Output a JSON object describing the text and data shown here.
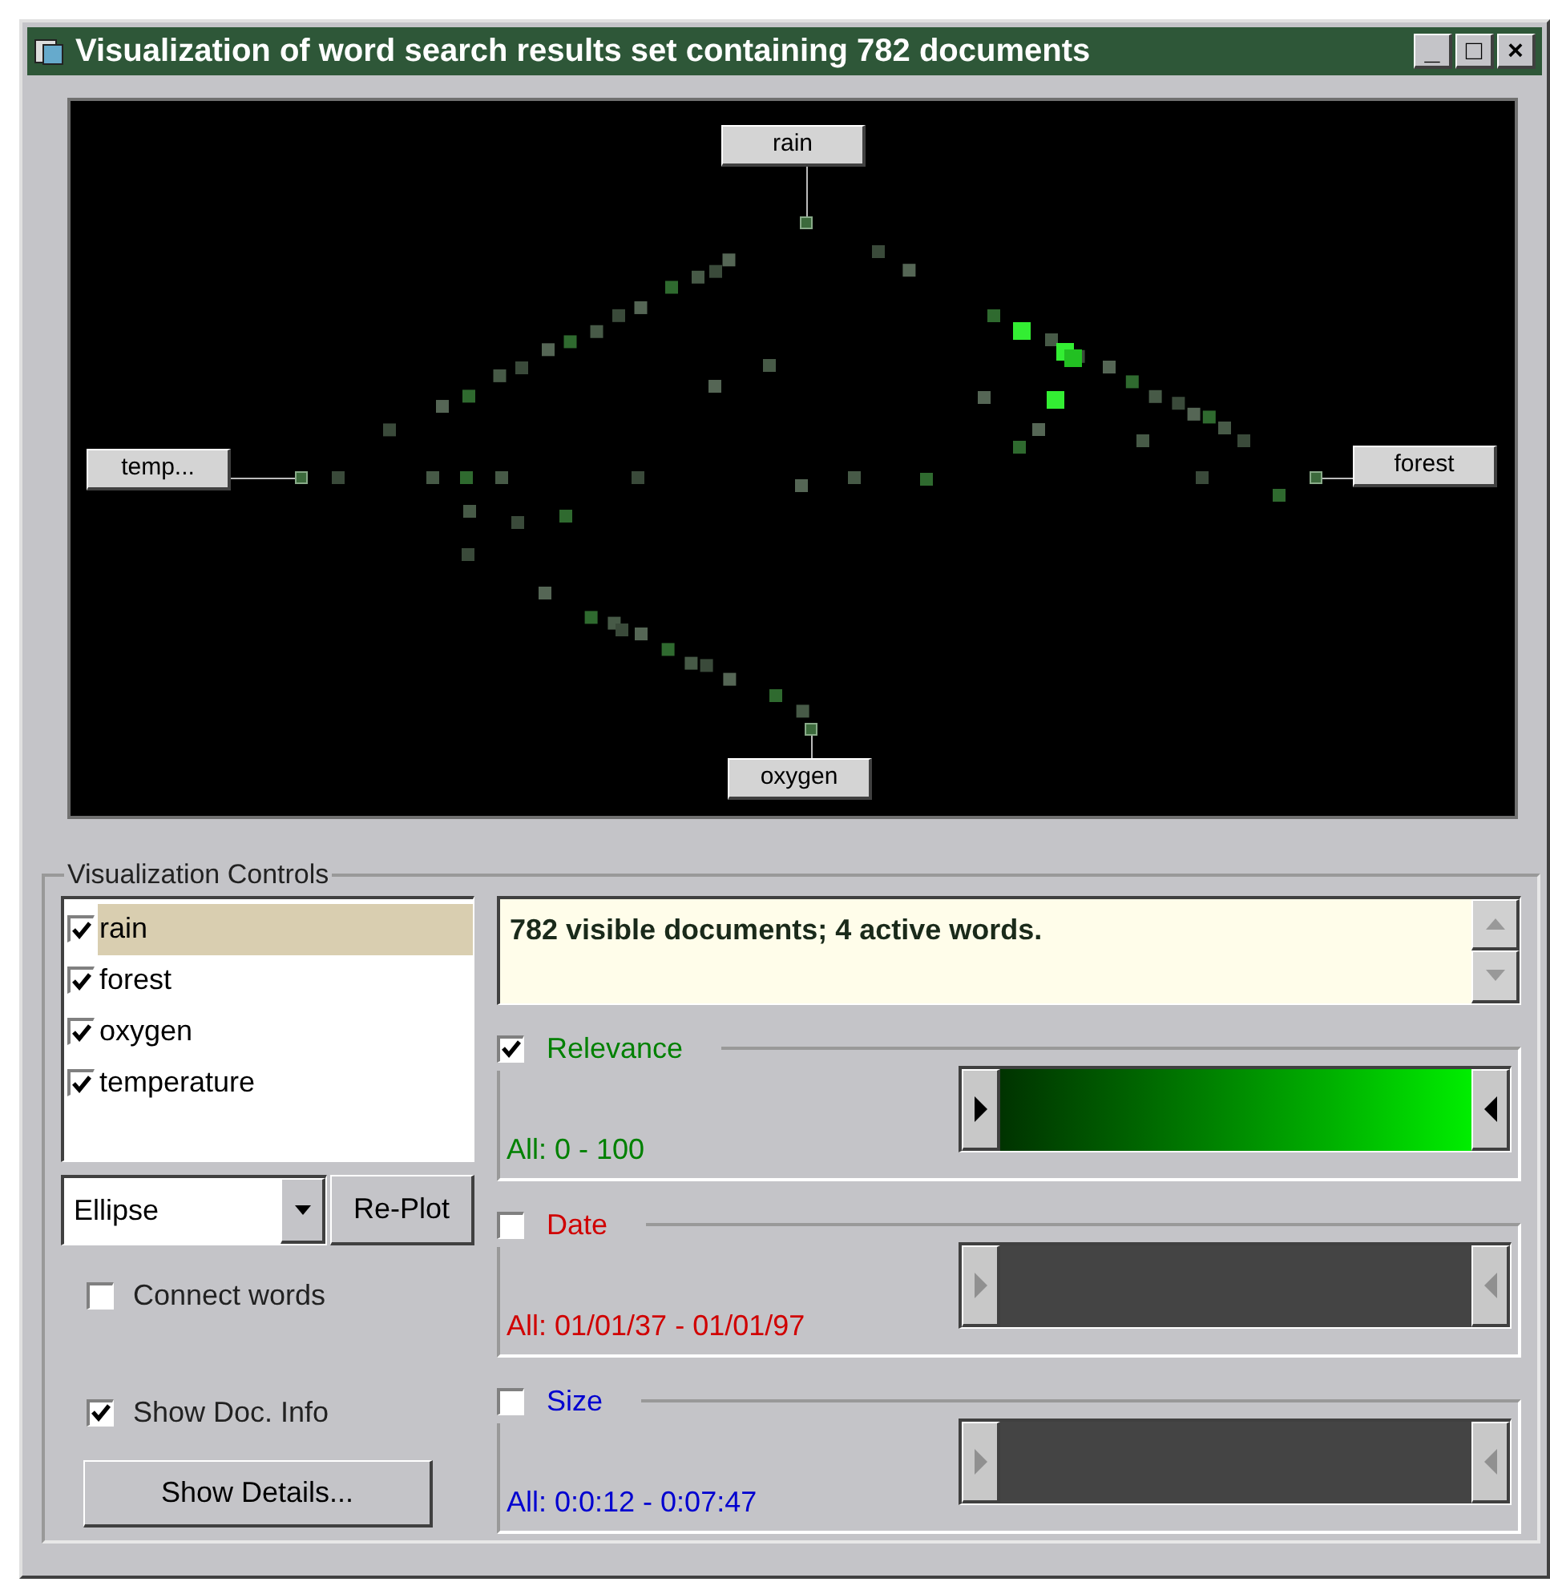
{
  "window": {
    "title": "Visualization of word search results set containing 782 documents",
    "controls": [
      "_",
      "□",
      "×"
    ]
  },
  "canvas": {
    "words": [
      {
        "label": "rain",
        "kind": "top"
      },
      {
        "label": "temp...",
        "kind": "left"
      },
      {
        "label": "forest",
        "kind": "right"
      },
      {
        "label": "oxygen",
        "kind": "bottom"
      }
    ]
  },
  "controls": {
    "title": "Visualization Controls",
    "word_list": [
      {
        "label": "rain",
        "checked": true,
        "selected": true
      },
      {
        "label": "forest",
        "checked": true,
        "selected": false
      },
      {
        "label": "oxygen",
        "checked": true,
        "selected": false
      },
      {
        "label": "temperature",
        "checked": true,
        "selected": false
      }
    ],
    "layout_dropdown": {
      "value": "Ellipse"
    },
    "replot_button": "Re-Plot",
    "options": [
      {
        "label": "Connect words",
        "checked": false
      },
      {
        "label": "Show Doc. Info",
        "checked": true
      }
    ],
    "details_button": "Show Details...",
    "status": "782 visible documents; 4 active words.",
    "filters": [
      {
        "label": "Relevance",
        "checked": true,
        "color": "#008000",
        "range": "All: 0 - 100"
      },
      {
        "label": "Date",
        "checked": false,
        "color": "#d00000",
        "range": "All: 01/01/37 - 01/01/97"
      },
      {
        "label": "Size",
        "checked": false,
        "color": "#0000d0",
        "range": "All: 0:0:12 - 0:07:47"
      }
    ]
  }
}
